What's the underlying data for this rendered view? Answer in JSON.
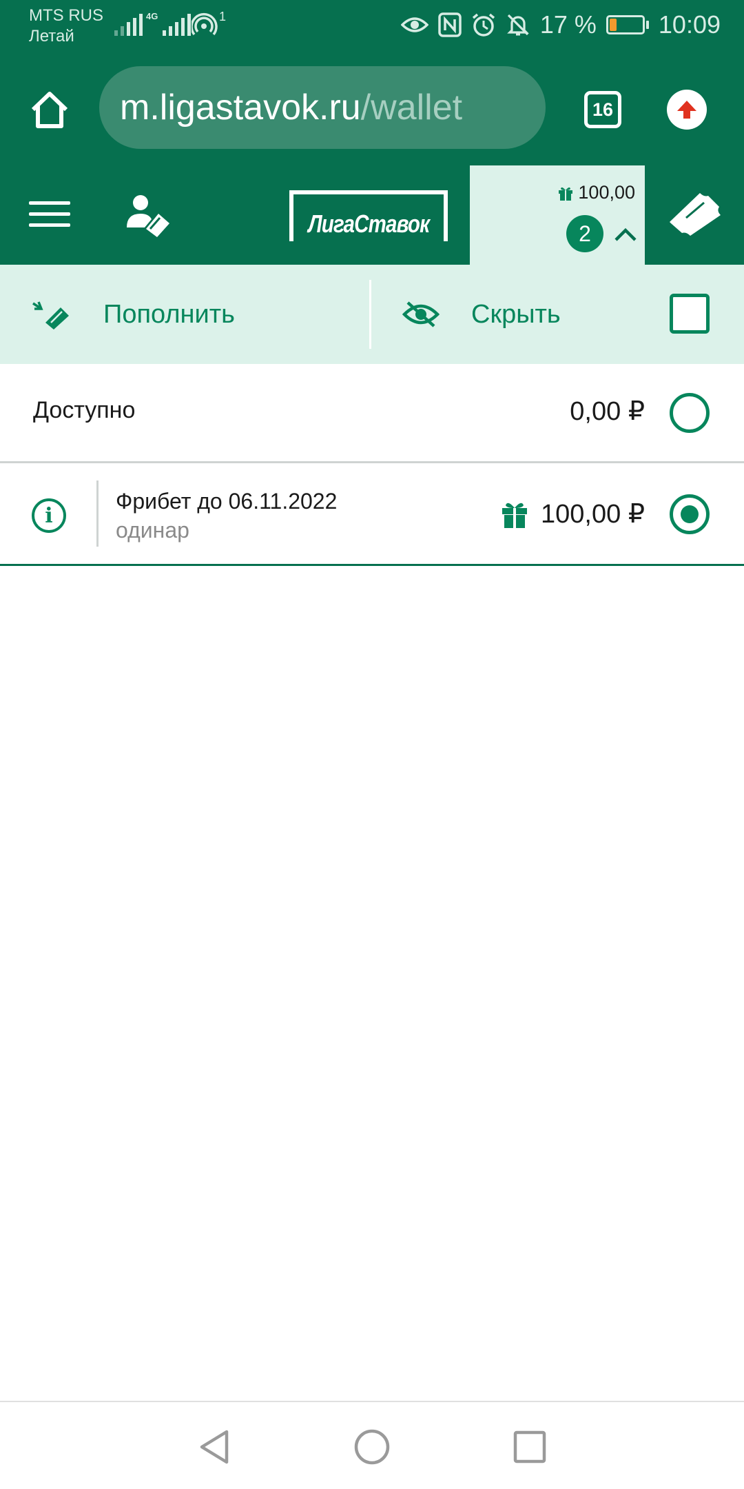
{
  "status_bar": {
    "carrier_name": "MTS RUS",
    "carrier_sub": "Летай",
    "network_type": "4G",
    "hotspot_count": "1",
    "battery_percent": "17 %",
    "time": "10:09",
    "icons": [
      "eye-icon",
      "nfc-icon",
      "alarm-icon",
      "bell-off-icon",
      "battery-icon"
    ]
  },
  "browser": {
    "url_host": "m.ligastavok.ru",
    "url_path": "/wallet",
    "tab_count": "16"
  },
  "header": {
    "logo_text": "ЛигаСтавок",
    "bonus_balance": "100,00",
    "bet_count": "2"
  },
  "actions": {
    "deposit_label": "Пополнить",
    "hide_label": "Скрыть"
  },
  "wallet": {
    "available": {
      "label": "Доступно",
      "amount": "0,00 ₽",
      "selected": false
    },
    "freebet": {
      "title": "Фрибет до 06.11.2022",
      "subtitle": "одинар",
      "amount": "100,00 ₽",
      "selected": true
    }
  },
  "colors": {
    "brand_green": "#06704f",
    "accent_green": "#07865c",
    "light_panel": "#dcf2ea"
  }
}
